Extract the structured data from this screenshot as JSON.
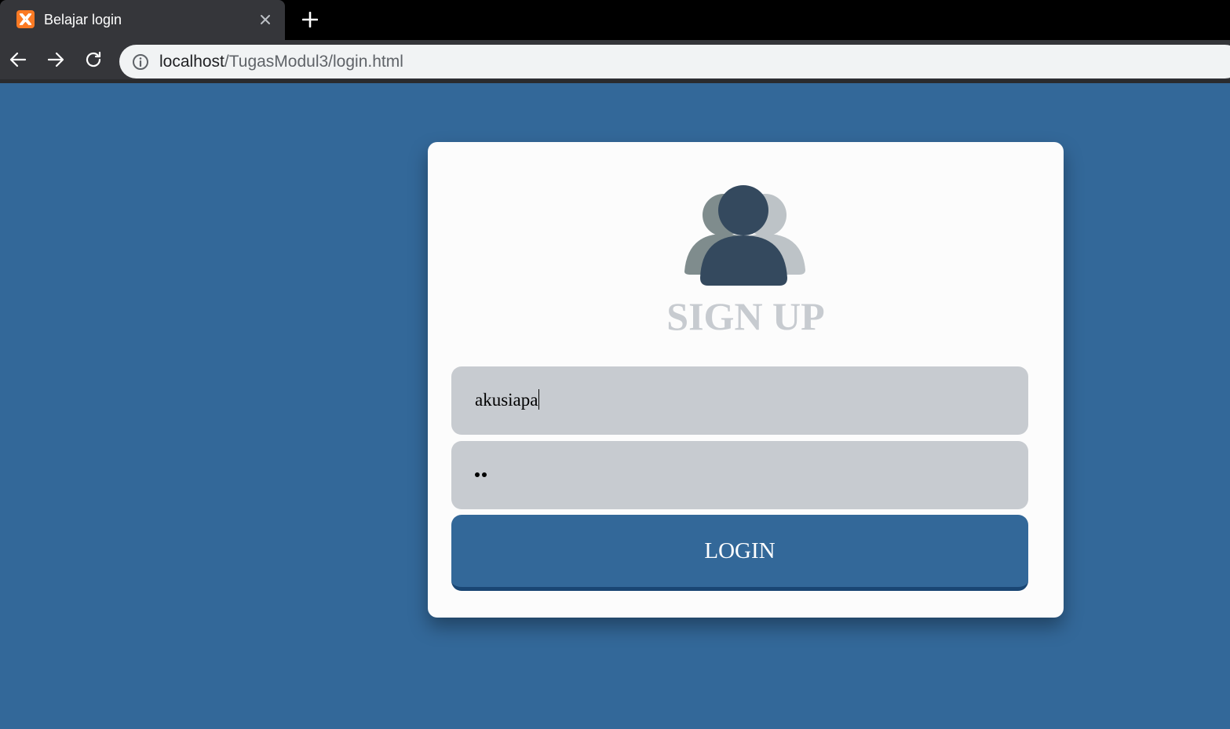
{
  "browser": {
    "tab_title": "Belajar login",
    "favicon": "xampp-icon",
    "url_host": "localhost",
    "url_path": "/TugasModul3/login.html"
  },
  "form": {
    "title": "SIGN UP",
    "username_value": "akusiapa",
    "password_mask_count": 2,
    "login_label": "LOGIN"
  },
  "colors": {
    "background": "#336899",
    "card": "#fcfcfc",
    "field": "#c7cbd0",
    "title": "#c7cbd0",
    "button": "#336899",
    "avatar_front": "#34495e",
    "avatar_back_left": "#7f8c8d",
    "avatar_back_right": "#bdc3c7"
  }
}
